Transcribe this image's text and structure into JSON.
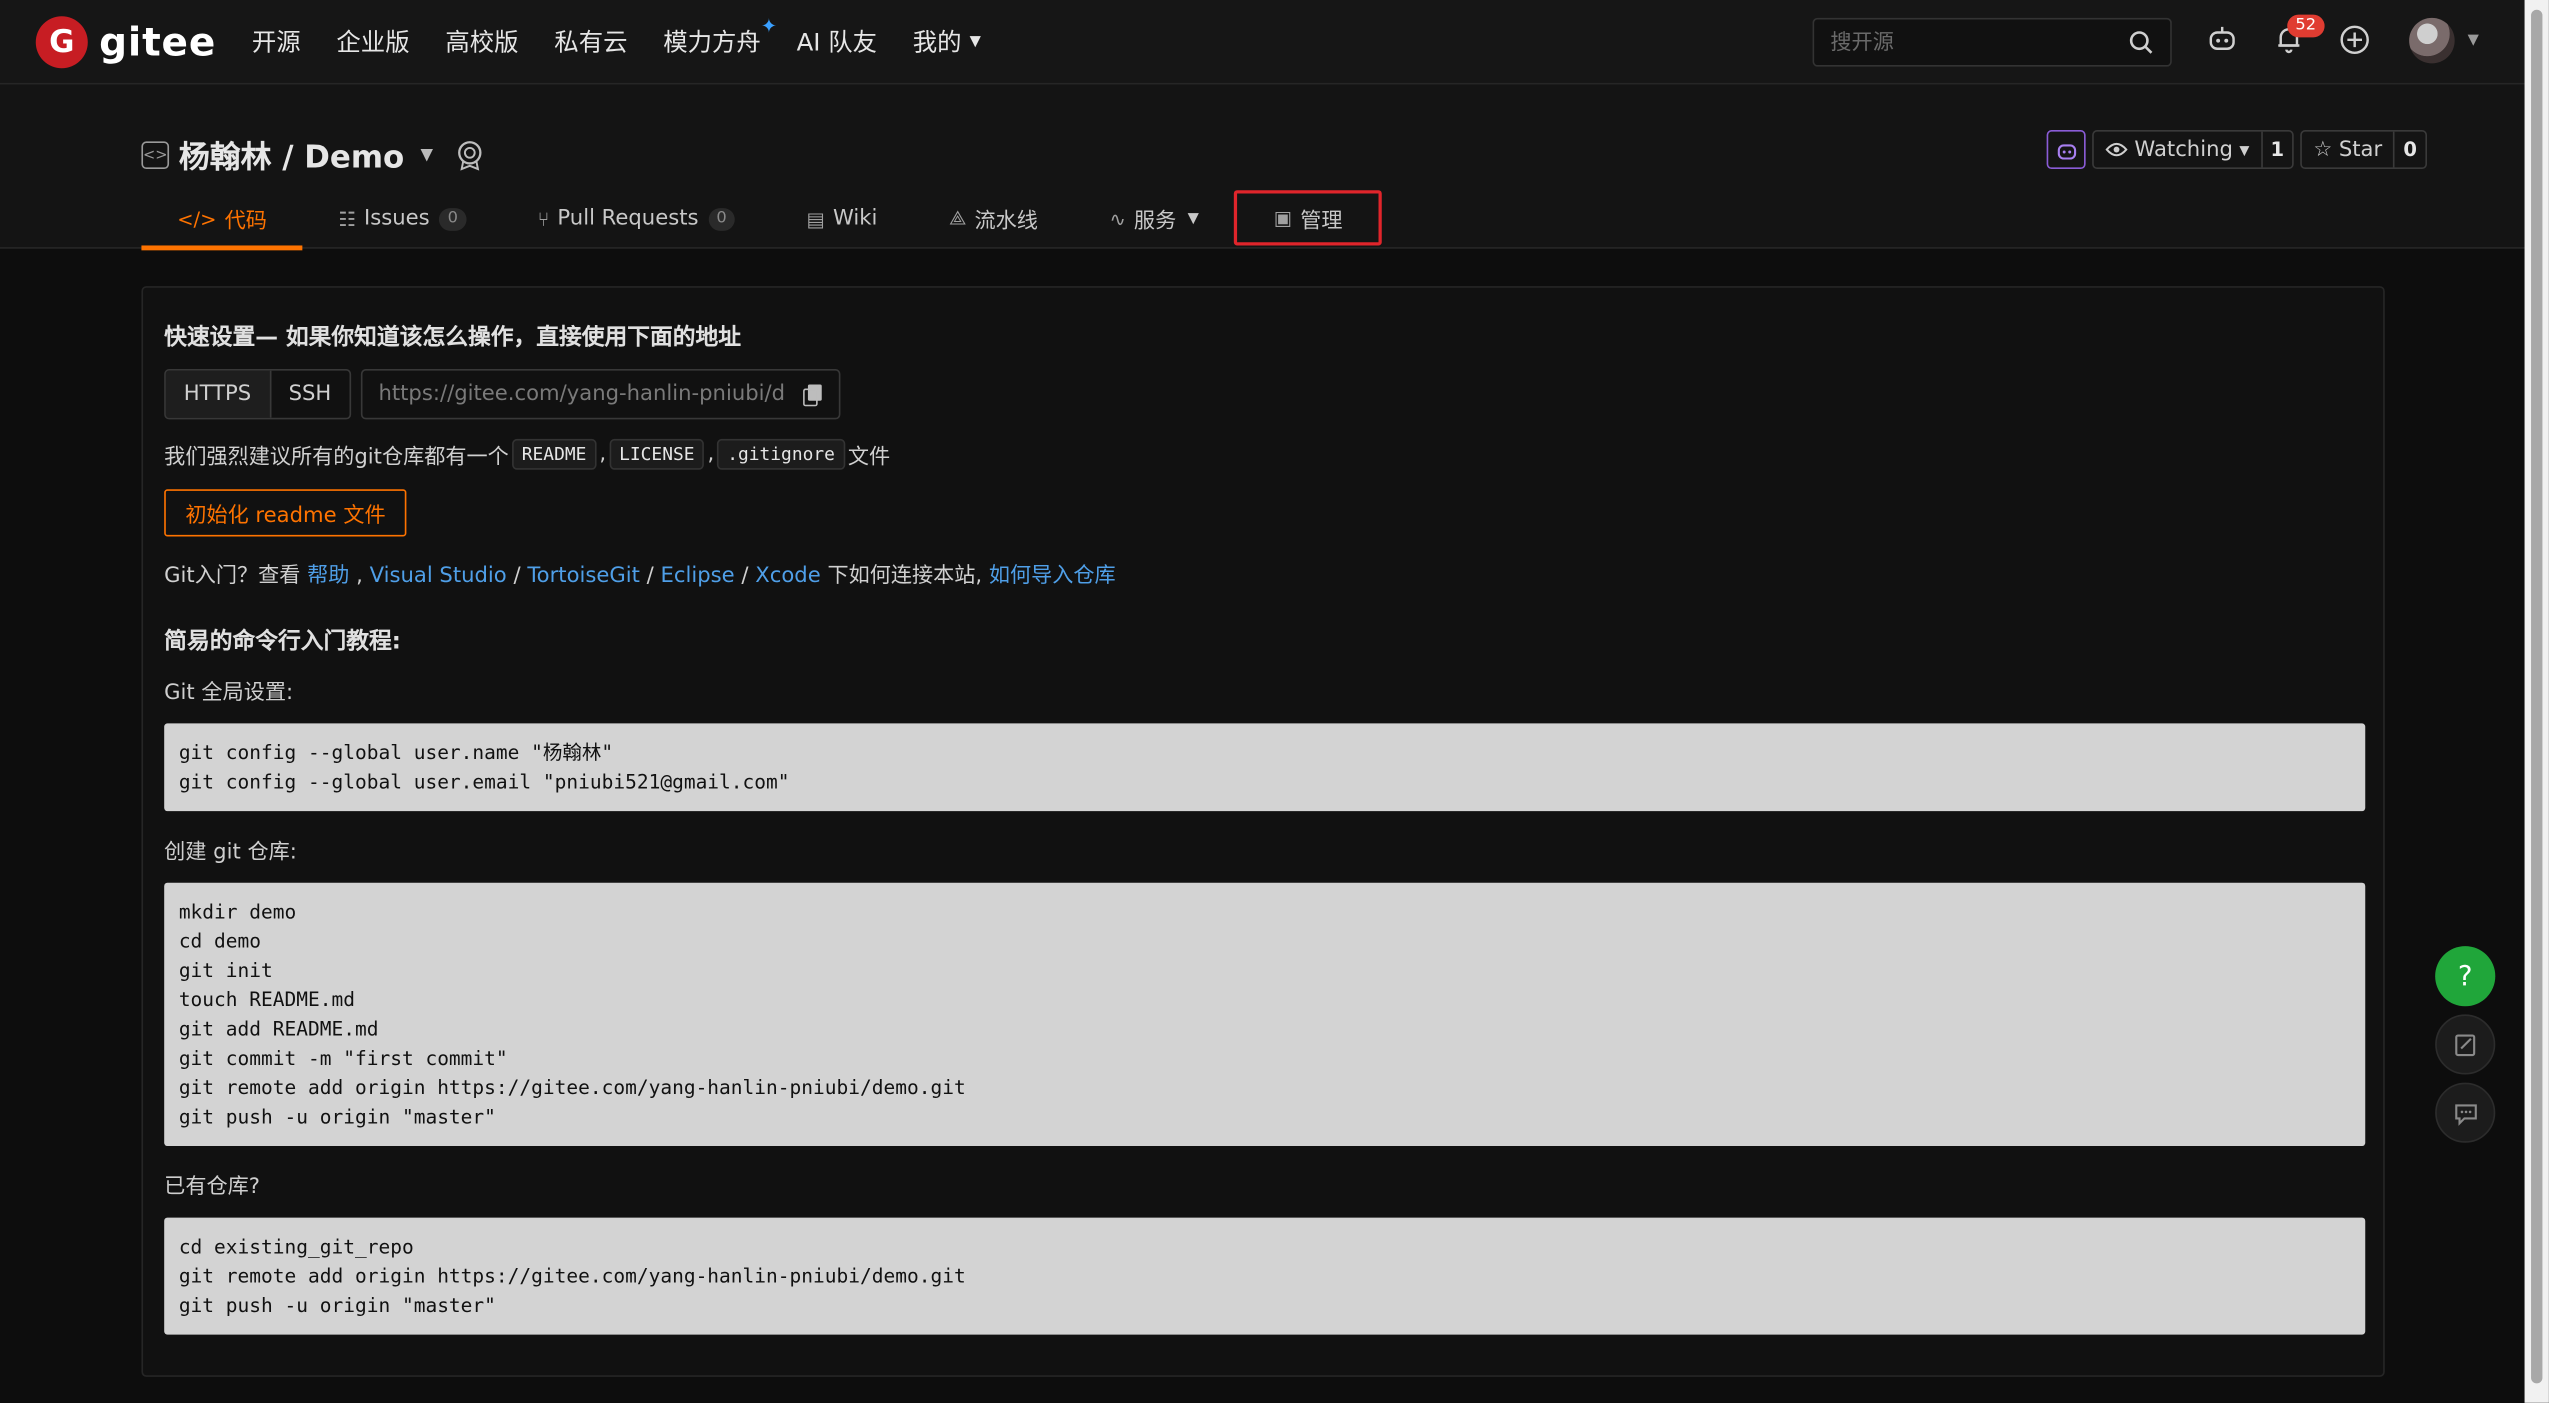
{
  "topnav": {
    "logo_text": "gitee",
    "logo_letter": "G",
    "links": [
      "开源",
      "企业版",
      "高校版",
      "私有云",
      "模力方舟",
      "AI 队友",
      "我的"
    ],
    "search_placeholder": "搜开源",
    "notification_count": "52"
  },
  "repo": {
    "title": "杨翰林 / Demo",
    "watch_label": "Watching",
    "watch_count": "1",
    "star_label": "Star",
    "star_count": "0"
  },
  "tabs": {
    "code": "代码",
    "issues": "Issues",
    "issues_count": "0",
    "pulls": "Pull Requests",
    "pulls_count": "0",
    "wiki": "Wiki",
    "pipeline": "流水线",
    "services": "服务",
    "manage": "管理"
  },
  "quickstart": {
    "title": "快速设置— 如果你知道该怎么操作，直接使用下面的地址",
    "protocols": [
      "HTTPS",
      "SSH"
    ],
    "clone_url": "https://gitee.com/yang-hanlin-pniubi/demo.git",
    "recommend_prefix": "我们强烈建议所有的git仓库都有一个",
    "recommend_files": [
      "README",
      "LICENSE",
      ".gitignore"
    ],
    "recommend_suffix": "文件",
    "sep_comma": ",",
    "init_button": "初始化 readme 文件",
    "help_prefix": "Git入门？查看",
    "help_link": "帮助",
    "vs_link": "Visual Studio",
    "tortoise_link": "TortoiseGit",
    "eclipse_link": "Eclipse",
    "xcode_link": "Xcode",
    "help_middle": "下如何连接本站,",
    "import_link": "如何导入仓库",
    "sep_slash": "/",
    "sep_comma_space": ","
  },
  "tutorial": {
    "title": "简易的命令行入门教程:",
    "global_label": "Git 全局设置:",
    "global_lines": [
      "git config --global user.name \"杨翰林\"",
      "git config --global user.email \"pniubi521@gmail.com\""
    ],
    "create_label": "创建 git 仓库:",
    "create_lines": [
      "mkdir demo",
      "cd demo",
      "git init",
      "touch README.md",
      "git add README.md",
      "git commit -m \"first commit\"",
      "git remote add origin https://gitee.com/yang-hanlin-pniubi/demo.git",
      "git push -u origin \"master\""
    ],
    "existing_label": "已有仓库?",
    "existing_lines": [
      "cd existing_git_repo",
      "git remote add origin https://gitee.com/yang-hanlin-pniubi/demo.git",
      "git push -u origin \"master\""
    ]
  },
  "fab": {
    "help_glyph": "?"
  },
  "colors": {
    "accent": "#fe7300",
    "link": "#4f9fe8",
    "brand": "#c71d23",
    "highlight_box": "#e0252b"
  }
}
